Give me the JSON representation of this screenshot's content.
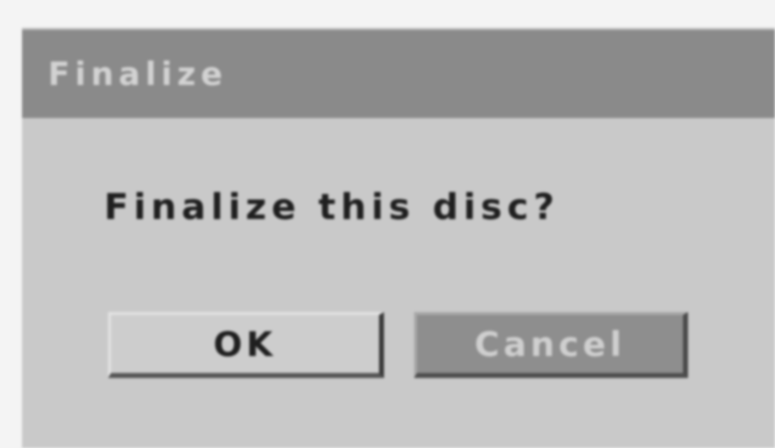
{
  "dialog": {
    "title": "Finalize",
    "message": "Finalize this disc?",
    "buttons": {
      "ok_label": "OK",
      "cancel_label": "Cancel"
    }
  },
  "colors": {
    "titlebar": "#8a8a8a",
    "dialog_body": "#c9c9c9",
    "ok_button": "#cdcdcd",
    "cancel_button": "#8e8e8e"
  }
}
